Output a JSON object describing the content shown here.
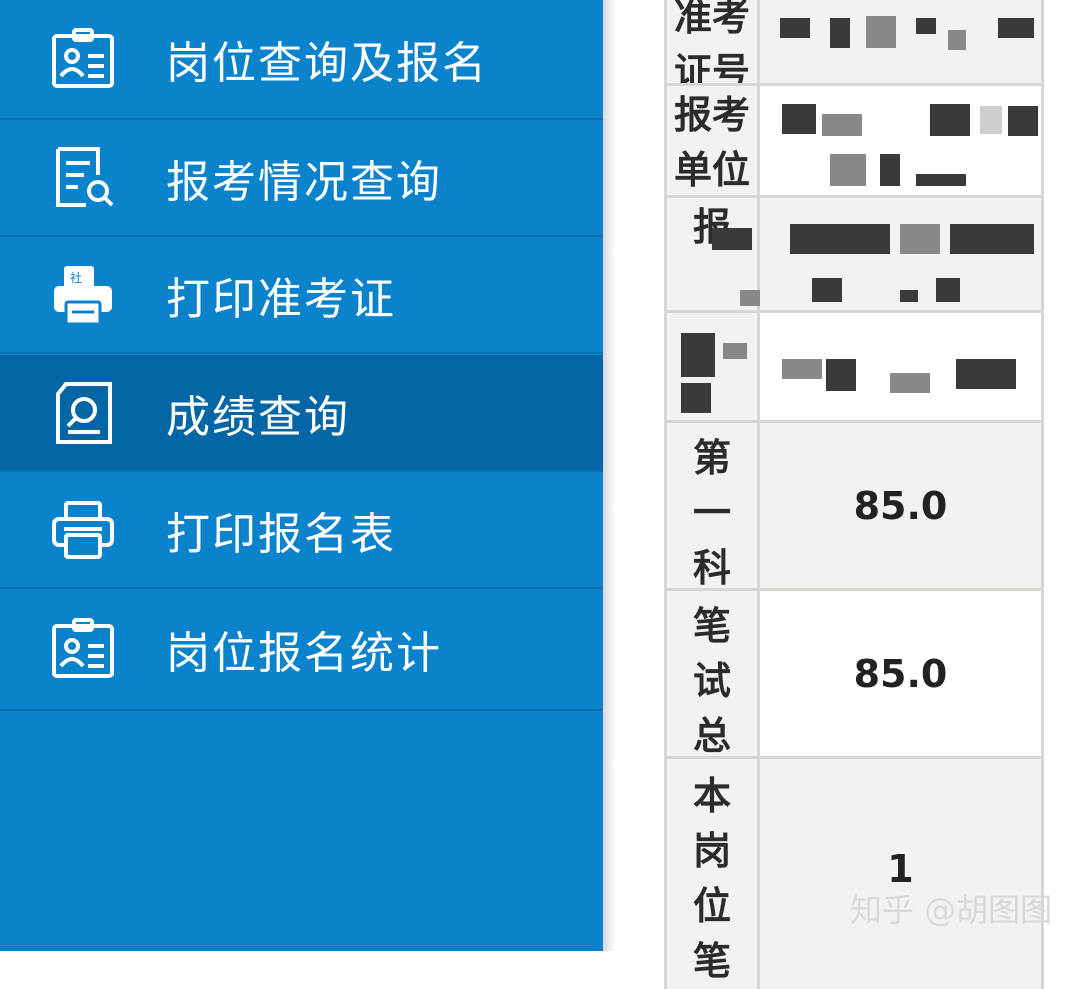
{
  "sidebar": {
    "items": [
      {
        "label": "岗位查询及报名",
        "icon": "id-badge-icon"
      },
      {
        "label": "报考情况查询",
        "icon": "document-search-icon"
      },
      {
        "label": "打印准考证",
        "icon": "printer-ticket-icon"
      },
      {
        "label": "成绩查询",
        "icon": "score-document-icon",
        "active": true
      },
      {
        "label": "打印报名表",
        "icon": "printer-icon"
      },
      {
        "label": "岗位报名统计",
        "icon": "id-badge-icon"
      }
    ]
  },
  "table": {
    "rows": [
      {
        "label": "准考证号",
        "value": ""
      },
      {
        "label": "报考单位",
        "value": ""
      },
      {
        "label": "报",
        "value": ""
      },
      {
        "label": "",
        "value": ""
      },
      {
        "label": "第一科目成绩",
        "value": "85.0"
      },
      {
        "label": "笔试总成绩",
        "value": "85.0"
      },
      {
        "label": "本岗位笔试名次",
        "value": "1"
      }
    ]
  },
  "watermark": "知乎 @胡图图",
  "colors": {
    "sidebar_bg": "#0a82cc",
    "sidebar_active": "#0566a6",
    "cell_bg": "#f3f2ef",
    "border": "#d6d6d6"
  }
}
